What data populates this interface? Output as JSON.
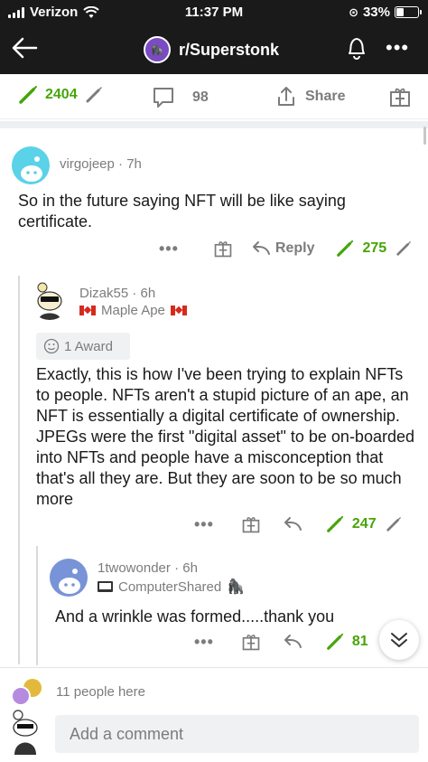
{
  "status_bar": {
    "carrier": "Verizon",
    "time": "11:37 PM",
    "battery": "33%",
    "battery_level": 0.33
  },
  "nav": {
    "subreddit": "r/Superstonk",
    "icons": [
      "back-arrow-icon",
      "bell-icon",
      "more-icon"
    ]
  },
  "post_actions": {
    "upvotes": "2404",
    "comments": "98",
    "share": "Share"
  },
  "comments": [
    {
      "username": "virgojeep",
      "age": "7h",
      "text": "So in the future saying NFT will be like saying certificate.",
      "reply_label": "Reply",
      "votes": "275"
    },
    {
      "username": "Dizak55",
      "age": "6h",
      "flair": "Maple Ape",
      "award": "1 Award",
      "text": "Exactly, this is how I've been trying to explain NFTs to people. NFTs aren't a stupid picture of an ape, an NFT is essentially a digital certificate of ownership. JPEGs were the first \"digital asset\" to be on-boarded into NFTs and people have a misconception that that's all they are. But they are soon to be so much more",
      "votes": "247"
    },
    {
      "username": "1twowonder",
      "age": "6h",
      "flair": "ComputerShared",
      "text": "And a wrinkle was formed.....thank you",
      "votes": "81"
    }
  ],
  "footer": {
    "people_here": "11 people here",
    "comment_placeholder": "Add a comment"
  },
  "colors": {
    "upvote_green": "#46a508",
    "nav_background": "#1a1a1b",
    "muted_text": "#7c7c7c"
  }
}
